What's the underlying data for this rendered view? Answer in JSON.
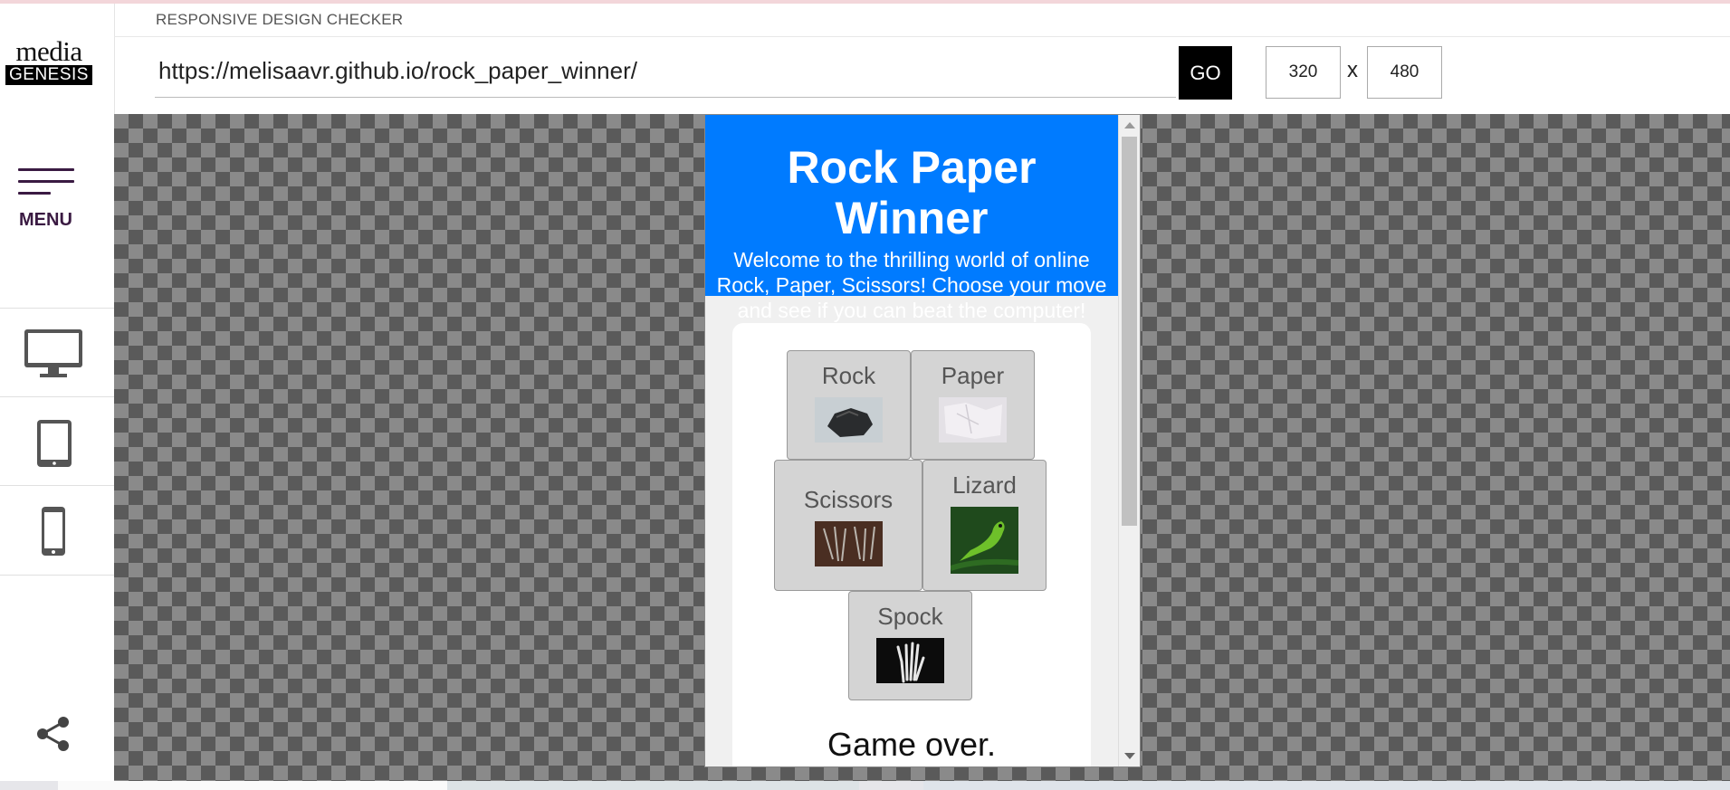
{
  "header": {
    "title": "RESPONSIVE DESIGN CHECKER",
    "url_value": "https://melisaavr.github.io/rock_paper_winner/",
    "go_label": "GO",
    "width_value": "320",
    "height_value": "480",
    "dim_separator": "x"
  },
  "sidebar": {
    "logo_top": "media",
    "logo_bottom": "GENESIS",
    "menu_label": "MENU",
    "devices": [
      "desktop-icon",
      "tablet-icon",
      "mobile-icon"
    ],
    "share_icon": "share-icon"
  },
  "site": {
    "title": "Rock Paper Winner",
    "description": "Welcome to the thrilling world of online Rock, Paper, Scissors! Choose your move and see if you can beat the computer!",
    "header_color": "#007bff",
    "choices": [
      {
        "label": "Rock"
      },
      {
        "label": "Paper"
      },
      {
        "label": "Scissors"
      },
      {
        "label": "Lizard"
      },
      {
        "label": "Spock"
      }
    ],
    "status": "Game over."
  }
}
